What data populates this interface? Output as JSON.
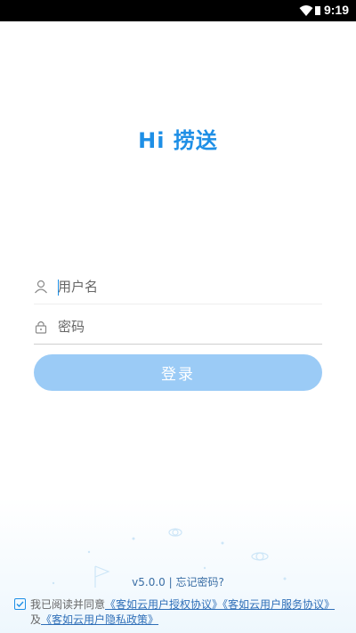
{
  "status_bar": {
    "time": "9:19",
    "icons": [
      "wifi-icon",
      "battery-icon"
    ]
  },
  "app": {
    "title": "Hi  捞送",
    "accent": "#1E8FE6"
  },
  "login_form": {
    "username_placeholder": "用户名",
    "password_placeholder": "密码",
    "submit_label": "登录",
    "button_color": "#9BCBF6"
  },
  "footer": {
    "version": "v5.0.0",
    "separator": "|",
    "forgot_password": "忘记密码?",
    "agreement": {
      "prefix": "我已阅读并同意",
      "link_auth": "《客如云用户授权协议》",
      "link_service": "《客如云用户服务协议》",
      "and": "及",
      "link_privacy": "《客如云用户隐私政策》",
      "checked": true
    }
  }
}
